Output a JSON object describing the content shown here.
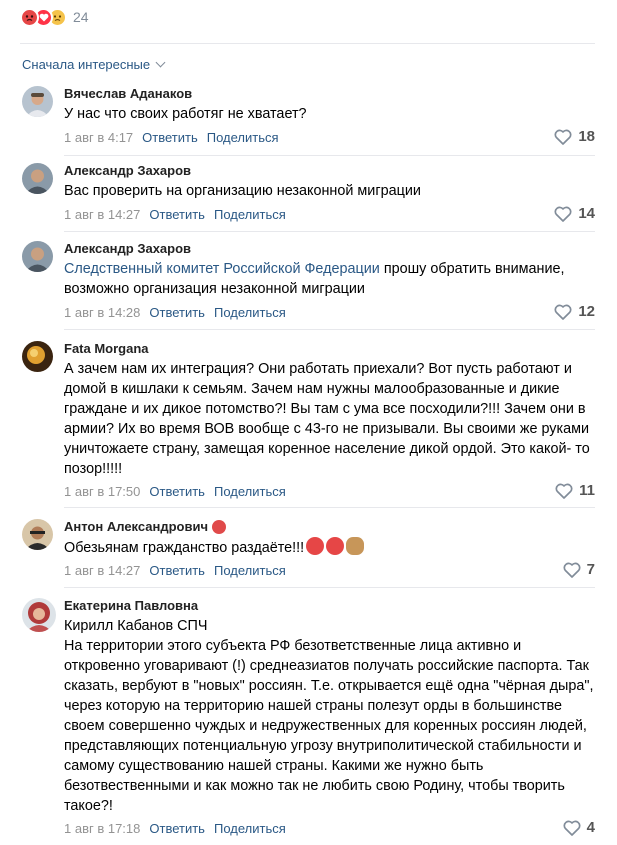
{
  "reactions": {
    "count": "24",
    "icons": [
      "angry-face-icon",
      "heart-icon",
      "sad-face-icon"
    ],
    "colors": {
      "angry": "#e64646",
      "heart": "#ff3347",
      "sad": "#f5c34a"
    }
  },
  "sort": {
    "label": "Сначала интересные"
  },
  "actions": {
    "reply": "Ответить",
    "share": "Поделиться"
  },
  "comments": [
    {
      "author": "Вячеслав Аданаков",
      "text": "У нас что своих работяг не хватает?",
      "time": "1 авг в 4:17",
      "likes": "18"
    },
    {
      "author": "Александр Захаров",
      "text": "Вас проверить на организацию незаконной миграции",
      "time": "1 авг в 14:27",
      "likes": "14"
    },
    {
      "author": "Александр Захаров",
      "mention": "Следственный комитет Российской Федерации",
      "text": " прошу обратить внимание, возможно организация незаконной миграции",
      "time": "1 авг в 14:28",
      "likes": "12"
    },
    {
      "author": "Fata Morgana",
      "text": "А зачем нам их интеграция? Они работать приехали? Вот пусть работают и домой в кишлаки к семьям. Зачем нам нужны малообразованные и дикие граждане и их дикое потомство?! Вы там с ума все посходили?!!! Зачем они в армии? Их во время ВОВ вообще с 43-го не призывали. Вы своими же руками уничтожаете страну, замещая коренное население дикой ордой. Это какой- то позор!!!!!",
      "time": "1 авг в 17:50",
      "likes": "11"
    },
    {
      "author": "Антон Александрович",
      "text": "Обезьянам гражданство раздаёте!!!",
      "time": "1 авг в 14:27",
      "likes": "7"
    },
    {
      "author": "Екатерина Павловна",
      "line1": "Кирилл Кабанов СПЧ",
      "text": "На территории этого субъекта РФ безответственные лица активно и откровенно уговаривают (!) среднеазиатов получать российские паспорта. Так сказать, вербуют в \"новых\" россиян. Т.е. открывается ещё одна \"чёрная дыра\", через которую на территорию нашей страны полезут орды в большинстве своем совершенно чуждых и недружественных для коренных россиян людей, представляющих потенциальную угрозу внутриполитической стабильности и самому существованию нашей страны. Какими же нужно быть безотвественными и как можно так не любить свою Родину, чтобы творить такое?!",
      "time": "1 авг в 17:18",
      "likes": "4"
    }
  ]
}
